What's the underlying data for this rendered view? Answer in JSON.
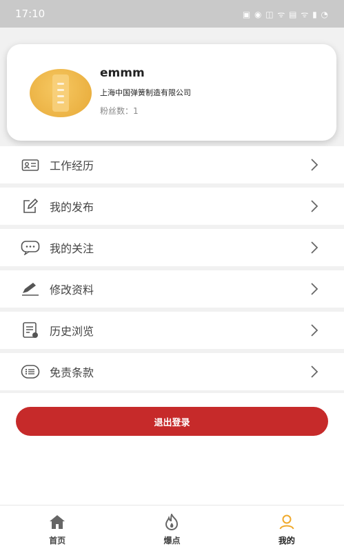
{
  "status_bar": {
    "time": "17:10",
    "icons": "▣ ◉ ◫ ᯤ ▤ ᯤ ▮ ◔"
  },
  "profile": {
    "name": "emmm",
    "company": "上海中国弹簧制造有限公司",
    "fans": "粉丝数：1"
  },
  "menu": {
    "items": [
      {
        "label": "工作经历",
        "icon": "id-card-icon"
      },
      {
        "label": "我的发布",
        "icon": "edit-icon"
      },
      {
        "label": "我的关注",
        "icon": "chat-bubble-icon"
      },
      {
        "label": "修改资料",
        "icon": "pen-icon"
      },
      {
        "label": "历史浏览",
        "icon": "document-history-icon"
      },
      {
        "label": "免责条款",
        "icon": "list-icon"
      }
    ]
  },
  "logout": {
    "label": "退出登录"
  },
  "tabs": [
    {
      "label": "首页",
      "icon": "home-icon"
    },
    {
      "label": "爆点",
      "icon": "flame-icon"
    },
    {
      "label": "我的",
      "icon": "user-icon",
      "active": true
    }
  ],
  "colors": {
    "accent": "#c62a2a",
    "active_tab": "#f0a92a",
    "inactive_tab": "#666666"
  }
}
